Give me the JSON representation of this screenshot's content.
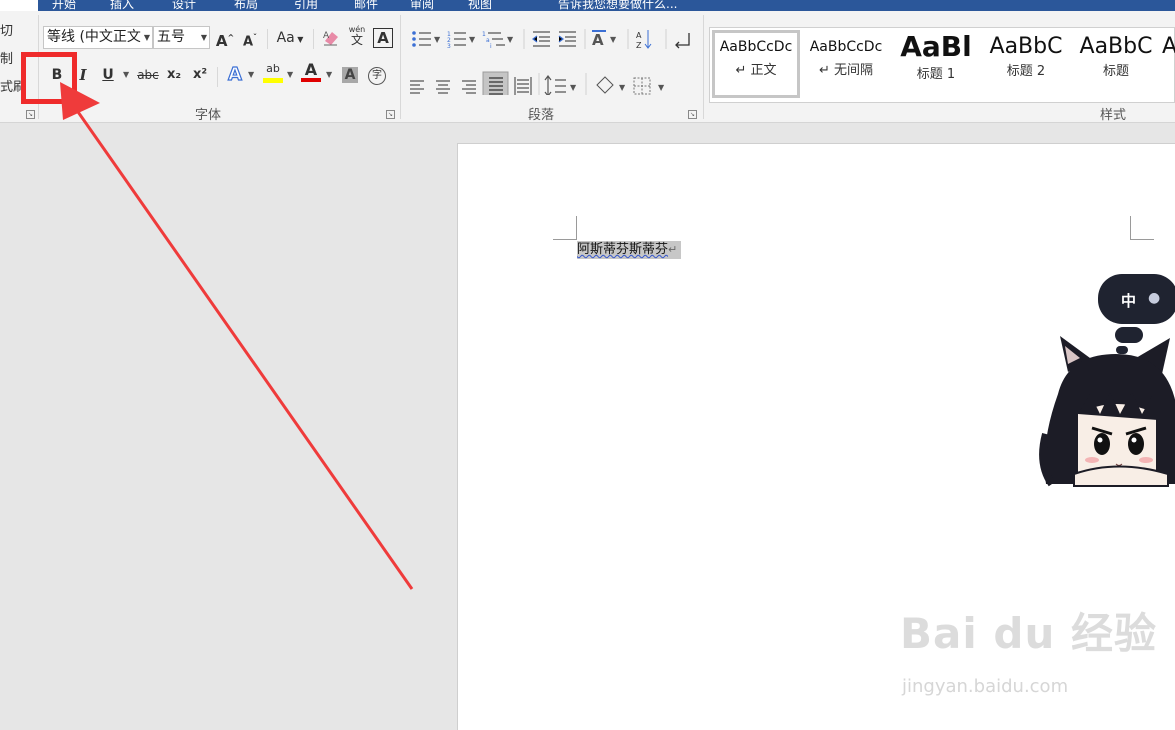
{
  "ribbon_tabs": [
    "开始",
    "插入",
    "设计",
    "布局",
    "引用",
    "邮件",
    "审阅",
    "视图",
    "告诉我您想要做什么..."
  ],
  "clipboard": {
    "cut_label": "切",
    "copy_label": "制",
    "format_painter_label": "式刷"
  },
  "font": {
    "font_name": "等线 (中文正文",
    "font_size": "五号",
    "grow_label": "A",
    "shrink_label": "A",
    "case_label": "Aa",
    "phonetic_top": "wén",
    "phonetic_bottom": "文",
    "border_label": "A",
    "bold_label": "B",
    "italic_label": "I",
    "underline_label": "U",
    "strike_label": "abc",
    "subscript_label": "x₂",
    "superscript_label": "x²",
    "effects_label": "A",
    "highlight_label": "ab",
    "font_color_label": "A",
    "shading_label": "A",
    "enclose_label": "字",
    "group_label": "字体",
    "highlight_color": "#ffff00",
    "font_color": "#e00000"
  },
  "paragraph": {
    "group_label": "段落"
  },
  "styles": {
    "group_label": "样式",
    "items": [
      {
        "sample": "AaBbCcDc",
        "name": "↵ 正文"
      },
      {
        "sample": "AaBbCcDc",
        "name": "↵ 无间隔"
      },
      {
        "sample": "AaBl",
        "name": "标题 1"
      },
      {
        "sample": "AaBbC",
        "name": "标题 2"
      },
      {
        "sample": "AaBbC",
        "name": "标题"
      },
      {
        "sample": "A",
        "name": ""
      }
    ]
  },
  "document": {
    "text": "阿斯蒂芬斯蒂芬",
    "para_mark": "↵"
  },
  "ime_bubble": {
    "mode": "中",
    "icon": "person-icon"
  },
  "watermark": {
    "brand": "Bai du 经验",
    "url": "jingyan.baidu.com"
  },
  "colors": {
    "ribbon_blue": "#2b579a",
    "annotation_red": "#ef2b2b"
  }
}
